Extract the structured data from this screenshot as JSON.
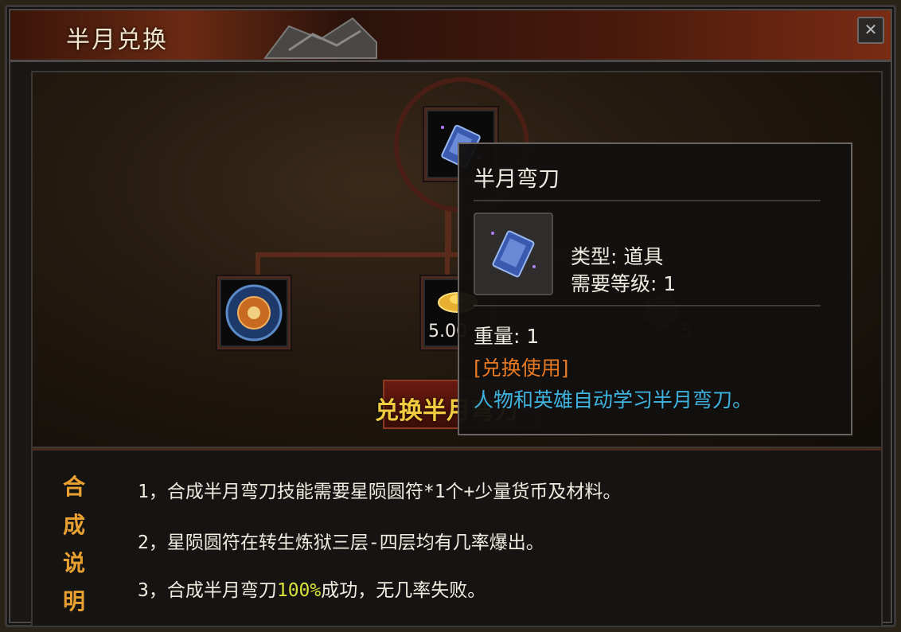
{
  "window": {
    "title": "半月兑换",
    "close_glyph": "✕"
  },
  "recipe": {
    "target_item": "半月弯刀",
    "materials": [
      {
        "name": "星陨圆符",
        "count": ""
      },
      {
        "name": "元宝",
        "count": "5.00"
      },
      {
        "name": "材料",
        "count": "5"
      }
    ],
    "exchange_button": "兑换半月弯刀"
  },
  "tooltip": {
    "title": "半月弯刀",
    "type_line": "类型: 道具",
    "level_line": "需要等级: 1",
    "weight_line": "重量: 1",
    "usage_tag": "[兑换使用]",
    "description": "人物和英雄自动学习半月弯刀。"
  },
  "instructions": {
    "side_label": [
      "合",
      "成",
      "说",
      "明"
    ],
    "lines": [
      {
        "prefix": "1，合成半月弯刀技能需要星陨圆符*1个+少量货币及材料。",
        "highlight": "",
        "suffix": ""
      },
      {
        "prefix": "2，星陨圆符在转生炼狱三层-四层均有几率爆出。",
        "highlight": "",
        "suffix": ""
      },
      {
        "prefix": "3，合成半月弯刀",
        "highlight": "100%",
        "suffix": "成功，无几率失败。"
      }
    ]
  },
  "colors": {
    "gold_text": "#f2cc40",
    "usage_orange": "#e87a24",
    "desc_blue": "#3fb3e0",
    "highlight_yellow": "#d8e23a"
  },
  "icons": {
    "book": "skill-book-icon",
    "talisman": "talisman-icon",
    "gold_ingot": "gold-ingot-icon",
    "material": "material-icon"
  }
}
